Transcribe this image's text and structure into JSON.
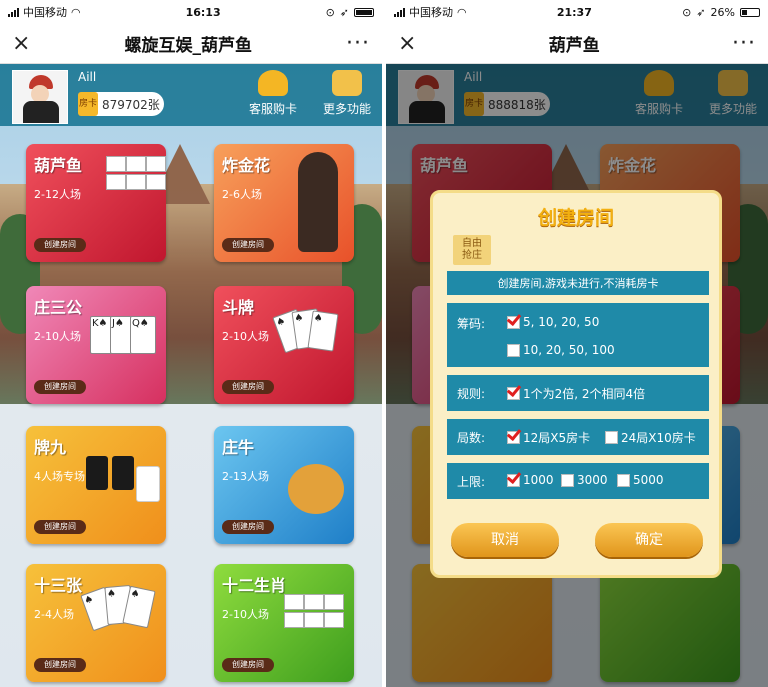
{
  "status": {
    "left": {
      "carrier": "中国移动",
      "time": "16:13"
    },
    "right": {
      "carrier": "中国移动",
      "time": "21:37",
      "battery": "26%"
    }
  },
  "nav": {
    "left_title": "螺旋互娱_葫芦鱼",
    "right_title": "葫芦鱼",
    "close_symbol": "×",
    "more_symbol": "···"
  },
  "header": {
    "username": "Aill",
    "card_icon_text": "房卡",
    "left_cards": "879702张",
    "right_cards": "888818张",
    "service_label": "客服购卡",
    "more_label": "更多功能"
  },
  "games": [
    {
      "name": "葫芦鱼",
      "players": "2-12人场",
      "button": "创建房间",
      "color": "#e0283f"
    },
    {
      "name": "炸金花",
      "players": "2-6人场",
      "button": "创建房间",
      "color": "#ee6a35"
    },
    {
      "name": "庄三公",
      "players": "2-10人场",
      "button": "创建房间",
      "color": "#e04c86"
    },
    {
      "name": "斗牌",
      "players": "2-10人场",
      "button": "创建房间",
      "color": "#e0283f"
    },
    {
      "name": "牌九",
      "players": "4人场专场",
      "button": "创建房间",
      "color": "#f0a022"
    },
    {
      "name": "庄牛",
      "players": "2-13人场",
      "button": "创建房间",
      "color": "#2a8dd6"
    },
    {
      "name": "十三张",
      "players": "2-4人场",
      "button": "创建房间",
      "color": "#f2b32a"
    },
    {
      "name": "十二生肖",
      "players": "2-10人场",
      "button": "创建房间",
      "color": "#5cb82c"
    }
  ],
  "dialog": {
    "title": "创建房间",
    "mode_tag": [
      "自由",
      "抢庄"
    ],
    "notice": "创建房间,游戏未进行,不消耗房卡",
    "chips_label": "筹码:",
    "chips_options": [
      {
        "text": "5, 10, 20, 50",
        "checked": true
      },
      {
        "text": "10, 20, 50, 100",
        "checked": false
      }
    ],
    "rules_label": "规则:",
    "rules_option": {
      "text": "1个为2倍, 2个相同4倍",
      "checked": true
    },
    "rounds_label": "局数:",
    "rounds_options": [
      {
        "text": "12局X5房卡",
        "checked": true
      },
      {
        "text": "24局X10房卡",
        "checked": false
      }
    ],
    "limit_label": "上限:",
    "limit_options": [
      {
        "text": "1000",
        "checked": true
      },
      {
        "text": "3000",
        "checked": false
      },
      {
        "text": "5000",
        "checked": false
      }
    ],
    "cancel": "取消",
    "confirm": "确定"
  }
}
